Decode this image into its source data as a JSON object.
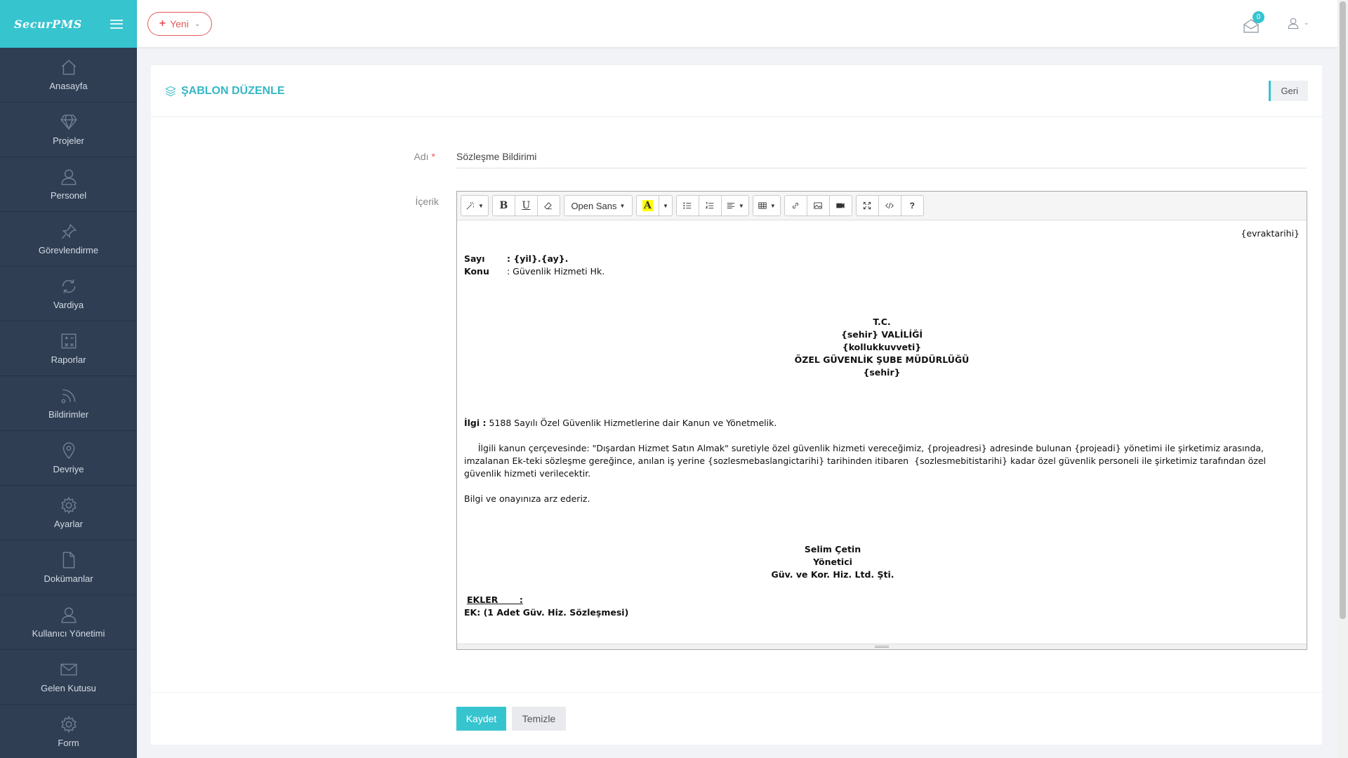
{
  "app": {
    "brand": "SecurPMS"
  },
  "sidebar": {
    "items": [
      {
        "label": "Anasayfa",
        "icon": "home-icon"
      },
      {
        "label": "Projeler",
        "icon": "diamond-icon"
      },
      {
        "label": "Personel",
        "icon": "user-icon"
      },
      {
        "label": "Görevlendirme",
        "icon": "pin-icon"
      },
      {
        "label": "Vardiya",
        "icon": "refresh-icon"
      },
      {
        "label": "Raporlar",
        "icon": "calculator-icon"
      },
      {
        "label": "Bildirimler",
        "icon": "rss-icon"
      },
      {
        "label": "Devriye",
        "icon": "location-icon"
      },
      {
        "label": "Ayarlar",
        "icon": "gear-icon"
      },
      {
        "label": "Dokümanlar",
        "icon": "document-icon"
      },
      {
        "label": "Kullanıcı Yönetimi",
        "icon": "user-icon"
      },
      {
        "label": "Gelen Kutusu",
        "icon": "mail-icon"
      },
      {
        "label": "Form",
        "icon": "gear-icon"
      }
    ]
  },
  "topbar": {
    "new_label": "Yeni",
    "mail_count": "0"
  },
  "page": {
    "title": "ŞABLON DÜZENLE",
    "back_label": "Geri"
  },
  "form": {
    "name_label": "Adı",
    "required_mark": "*",
    "name_value": "Sözleşme Bildirimi",
    "content_label": "İçerik",
    "save_label": "Kaydet",
    "clear_label": "Temizle"
  },
  "editor": {
    "font_name": "Open Sans",
    "highlight_letter": "A",
    "bold_letter": "B",
    "underline_letter": "U",
    "help_label": "?",
    "doc": {
      "date": "{evraktarihi}",
      "sayi_key": "Sayı",
      "sayi_value": ": {yil}.{ay}.",
      "konu_key": "Konu",
      "konu_value": ": Güvenlik Hizmeti Hk.",
      "header_lines": [
        "T.C.",
        "{sehir} VALİLİĞİ",
        "{kollukkuvveti}",
        "ÖZEL GÜVENLİK ŞUBE MÜDÜRLÜĞÜ",
        "{sehir}"
      ],
      "ilgi_key": "İlgi :",
      "ilgi_value": " 5188 Sayılı Özel Güvenlik Hizmetlerine dair Kanun ve Yönetmelik.",
      "body": "     İlgili kanun çerçevesinde: \"Dışardan Hizmet Satın Almak\" suretiyle özel güvenlik hizmeti vereceğimiz, {projeadresi} adresinde bulunan {projeadi} yönetimi ile şirketimiz arasında,  imzalanan Ek-teki sözleşme gereğince, anılan iş yerine {sozlesmebaslangictarihi} tarihinden itibaren  {sozlesmebitistarihi} kadar özel güvenlik personeli ile şirketimiz tarafından özel güvenlik hizmeti verilecektir.",
      "closing": "Bilgi ve onayınıza arz ederiz.",
      "signature_lines": [
        "Selim Çetin",
        "Yönetici",
        "Güv. ve Kor. Hiz. Ltd. Şti."
      ],
      "ekler_label": "EKLER       :",
      "ek_text": "EK: (1 Adet Güv. Hiz. Sözleşmesi)"
    }
  },
  "colors": {
    "accent": "#36c4cf",
    "sidebar": "#2f3e53",
    "danger": "#e25a5a"
  }
}
